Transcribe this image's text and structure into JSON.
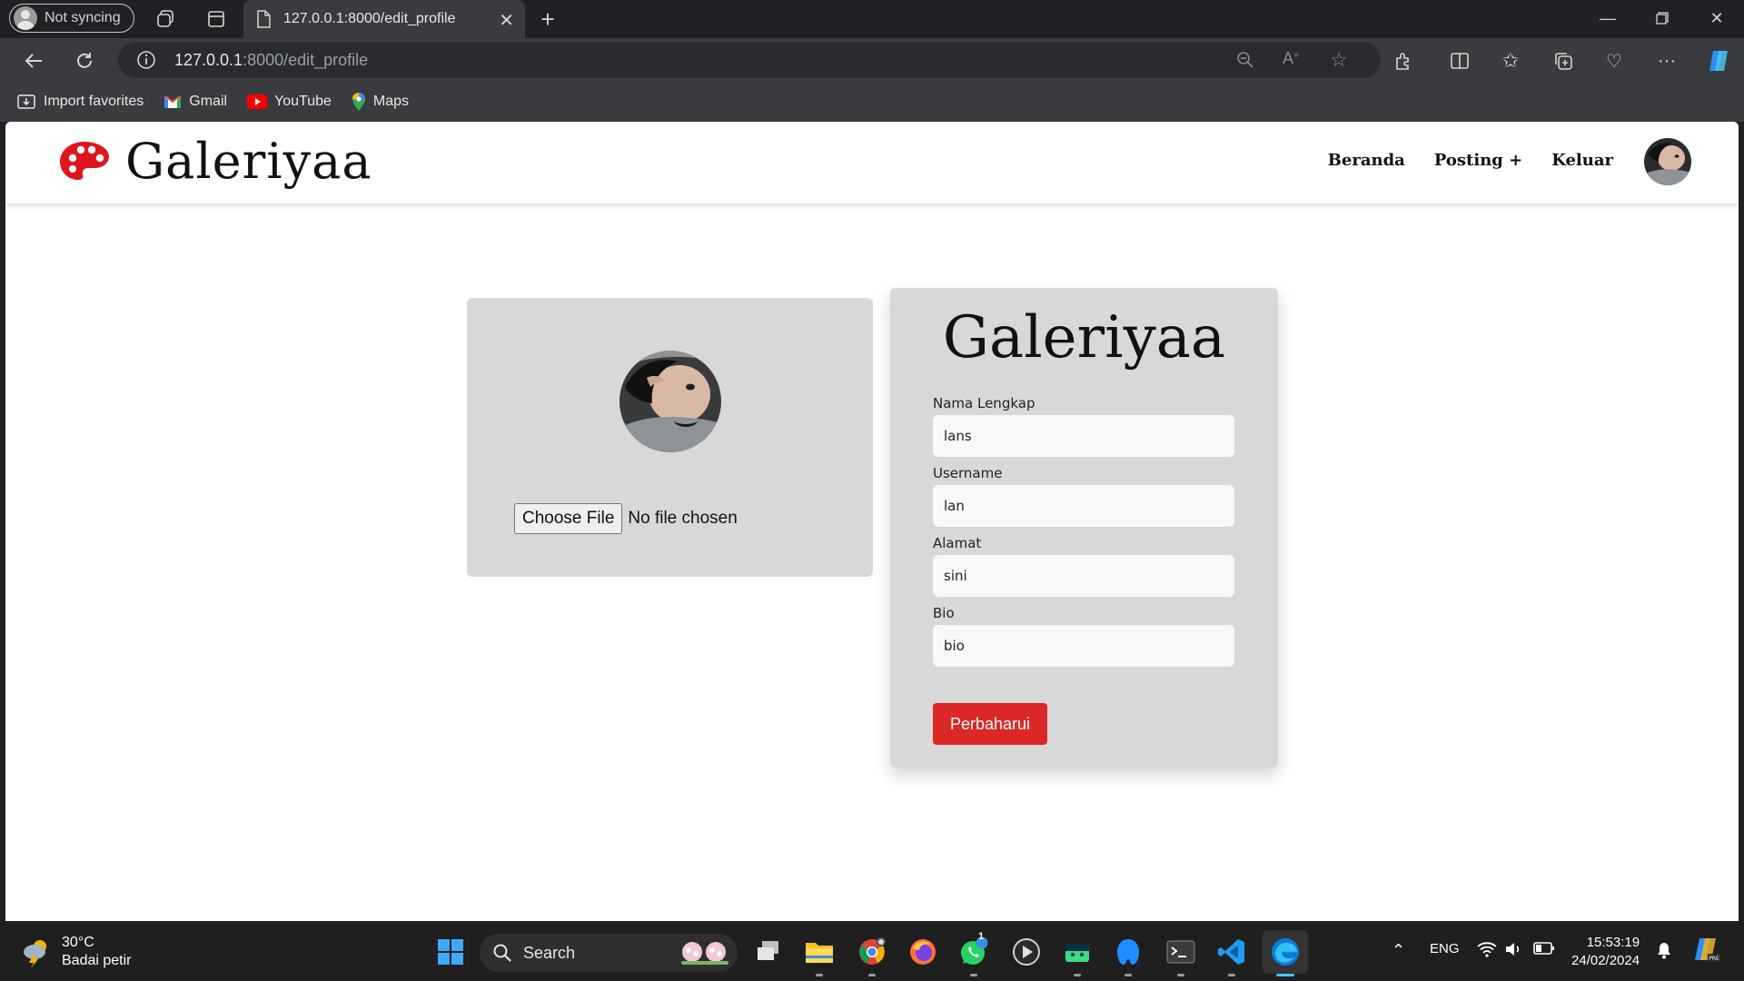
{
  "browser": {
    "profile_label": "Not syncing",
    "tab_title": "127.0.0.1:8000/edit_profile",
    "url_host": "127.0.0.1",
    "url_rest": ":8000/edit_profile",
    "favorites": [
      {
        "label": "Import favorites",
        "icon": "import-icon"
      },
      {
        "label": "Gmail",
        "icon": "gmail-icon"
      },
      {
        "label": "YouTube",
        "icon": "youtube-icon"
      },
      {
        "label": "Maps",
        "icon": "maps-icon"
      }
    ]
  },
  "site": {
    "brand": "Galeriyaa",
    "nav": {
      "home": "Beranda",
      "post": "Posting +",
      "logout": "Keluar"
    }
  },
  "upload": {
    "button_label": "Choose File",
    "status": "No file chosen"
  },
  "form": {
    "title": "Galeriyaa",
    "fields": [
      {
        "label": "Nama Lengkap",
        "value": "lans"
      },
      {
        "label": "Username",
        "value": "lan"
      },
      {
        "label": "Alamat",
        "value": "sini"
      },
      {
        "label": "Bio",
        "value": "bio"
      }
    ],
    "submit_label": "Perbaharui"
  },
  "taskbar": {
    "temperature": "30°C",
    "weather": "Badai petir",
    "search_label": "Search",
    "language": "ENG",
    "time": "15:53:19",
    "date": "24/02/2024",
    "whatsapp_badge": "1"
  },
  "colors": {
    "accent": "#dc2727",
    "card": "#d8d8d8",
    "brand_icon": "#e0141c"
  }
}
